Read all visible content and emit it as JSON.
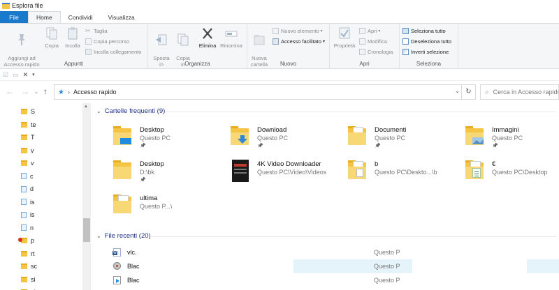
{
  "window": {
    "title": "Esplora file"
  },
  "tabs": [
    {
      "label": "File"
    },
    {
      "label": "Home"
    },
    {
      "label": "Condividi"
    },
    {
      "label": "Visualizza"
    }
  ],
  "ribbon": {
    "appunti": {
      "label": "Appunti",
      "pin": "Aggiungi ad\nAccesso rapido",
      "copy": "Copia",
      "paste": "Incolla",
      "cut": "Taglia",
      "copy_path": "Copia percorso",
      "paste_link": "Incolla collegamento"
    },
    "organizza": {
      "label": "Organizza",
      "move": "Sposta\nin",
      "copyto": "Copia\nin",
      "delete": "Elimina",
      "rename": "Rinomina"
    },
    "nuovo": {
      "label": "Nuovo",
      "new_folder": "Nuova\ncartella",
      "new_item": "Nuovo elemento",
      "easy_access": "Accesso facilitato"
    },
    "apri": {
      "label": "Apri",
      "properties": "Proprietà",
      "open": "Apri",
      "edit": "Modifica",
      "history": "Cronologia"
    },
    "seleziona": {
      "label": "Seleziona",
      "select_all": "Seleziona tutto",
      "select_none": "Deseleziona tutto",
      "invert": "Inverti selezione"
    }
  },
  "address": {
    "path": "Accesso rapido"
  },
  "search": {
    "placeholder": "Cerca in Accesso rapido"
  },
  "nav": {
    "items": [
      {
        "label": "S",
        "type": "folder"
      },
      {
        "label": "te",
        "type": "folder"
      },
      {
        "label": "T",
        "type": "folder"
      },
      {
        "label": "v",
        "type": "folder"
      },
      {
        "label": "v",
        "type": "folder"
      },
      {
        "label": "c",
        "type": "file"
      },
      {
        "label": "d",
        "type": "file"
      },
      {
        "label": "is",
        "type": "file"
      },
      {
        "label": "is",
        "type": "file"
      },
      {
        "label": "n",
        "type": "file"
      },
      {
        "label": "p",
        "type": "folder-badge"
      },
      {
        "label": "rt",
        "type": "folder"
      },
      {
        "label": "sc",
        "type": "folder"
      },
      {
        "label": "si",
        "type": "folder"
      },
      {
        "label": "si",
        "type": "folder"
      }
    ]
  },
  "frequent": {
    "header": "Cartelle frequenti (9)",
    "tiles": [
      {
        "name": "Desktop",
        "location": "Questo PC",
        "pinned": true,
        "overlay": "desktop"
      },
      {
        "name": "Download",
        "location": "Questo PC",
        "pinned": true,
        "overlay": "download"
      },
      {
        "name": "Documenti",
        "location": "Questo PC",
        "pinned": true,
        "overlay": "documents"
      },
      {
        "name": "Immagini",
        "location": "Questo PC",
        "pinned": true,
        "overlay": "pictures"
      },
      {
        "name": "Desktop",
        "location": "D:\\bk",
        "pinned": true,
        "overlay": "none"
      },
      {
        "name": "4K Video Downloader",
        "location": "Questo PC\\Video\\Videos",
        "pinned": false,
        "overlay": "video"
      },
      {
        "name": "b",
        "location": "Questo PC\\Deskto...\\b",
        "pinned": false,
        "overlay": "doc"
      },
      {
        "name": "€",
        "location": "Questo PC\\Desktop",
        "pinned": false,
        "overlay": "excel"
      },
      {
        "name": "ultima",
        "location": "Questo P...\\",
        "pinned": false,
        "overlay": "paper"
      }
    ]
  },
  "recent": {
    "header": "File recenti (20)",
    "rows": [
      {
        "name": "vlc.",
        "location": "Questo P",
        "icon": "word"
      },
      {
        "name": "Blac",
        "location": "Questo P",
        "icon": "disc"
      },
      {
        "name": "Blac",
        "location": "Questo P",
        "icon": "video"
      }
    ]
  },
  "colors": {
    "accent": "#1979ca",
    "folder": "#f4c542",
    "link": "#1e3287",
    "highlight": "#e5f3fb"
  }
}
